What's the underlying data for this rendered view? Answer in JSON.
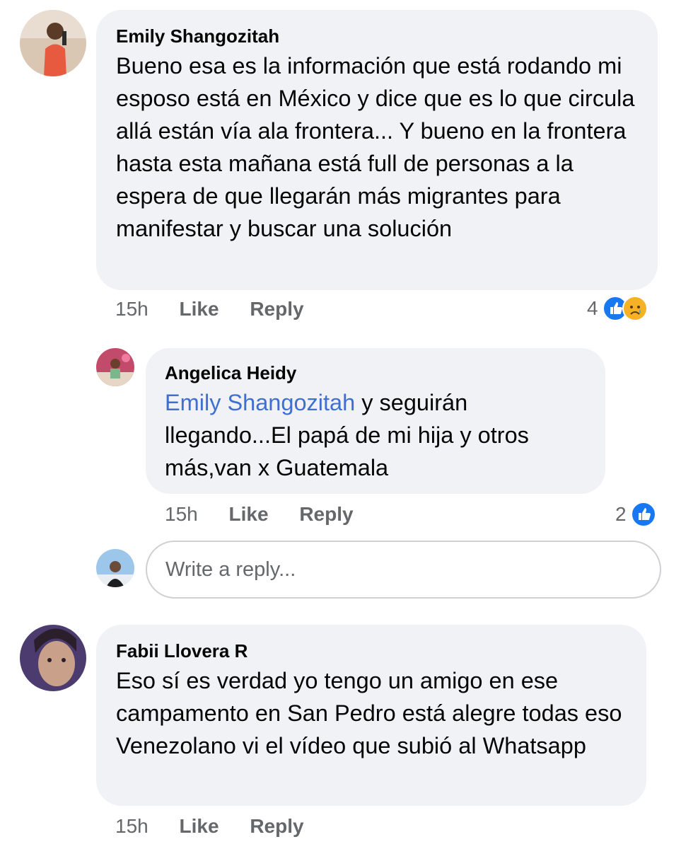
{
  "comments": [
    {
      "author": "Emily Shangozitah",
      "text": "Bueno esa es la información que está rodando mi esposo está en México y dice que es lo que circula allá están vía ala frontera... Y bueno en la frontera hasta esta mañana está full de personas a la espera de que llegarán más migrantes para manifestar y buscar una solución",
      "time": "15h",
      "like_label": "Like",
      "reply_label": "Reply",
      "reaction_count": "4",
      "reactions": [
        "like-icon",
        "sad-icon"
      ]
    },
    {
      "author": "Angelica Heidy",
      "mention": "Emily Shangozitah",
      "text": " y seguirán llegando...El papá de mi hija y otros más,van x Guatemala",
      "time": "15h",
      "like_label": "Like",
      "reply_label": "Reply",
      "reaction_count": "2",
      "reactions": [
        "like-icon"
      ]
    },
    {
      "author": "Fabii Llovera R",
      "text": "Eso sí es verdad yo tengo un amigo en ese campamento en San Pedro está alegre todas eso Venezolano vi el vídeo que subió al Whatsapp",
      "time": "15h",
      "like_label": "Like",
      "reply_label": "Reply"
    }
  ],
  "reply_box": {
    "placeholder": "Write a reply..."
  },
  "colors": {
    "bubble": "#f0f2f5",
    "mention": "#3f6fd0",
    "meta": "#65676b",
    "like": "#1877f2",
    "sad": "#f7b125"
  }
}
